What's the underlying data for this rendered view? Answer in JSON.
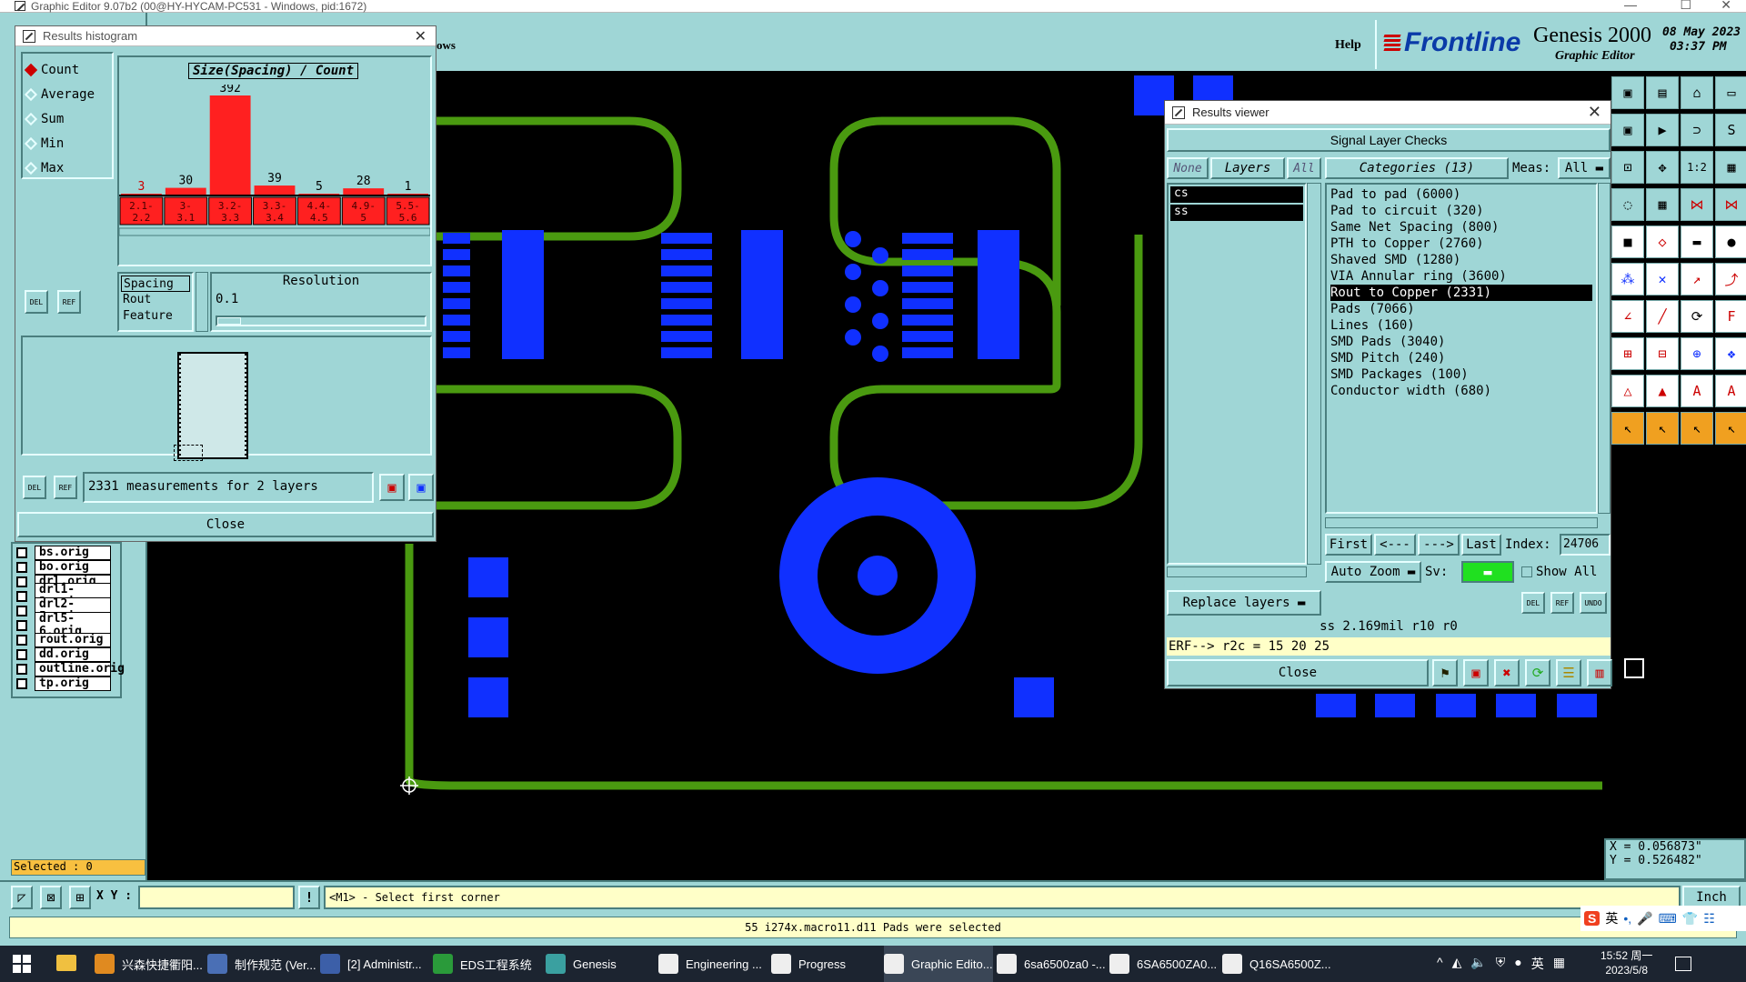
{
  "app": {
    "title": "Graphic Editor 9.07b2 (00@HY-HYCAM-PC531 - Windows, pid:1672)",
    "menu_partial": "ows",
    "help": "Help",
    "brand": "Frontline",
    "product": "Genesis 2000",
    "product_sub": "Graphic Editor",
    "date": "08 May 2023",
    "time": "03:37 PM"
  },
  "histogram": {
    "title": "Results histogram",
    "chart_title": "Size(Spacing) / Count",
    "modes": [
      {
        "label": "Count",
        "selected": true
      },
      {
        "label": "Average",
        "selected": false
      },
      {
        "label": "Sum",
        "selected": false
      },
      {
        "label": "Min",
        "selected": false
      },
      {
        "label": "Max",
        "selected": false
      }
    ],
    "types": [
      "Spacing",
      "Rout",
      "Feature"
    ],
    "resolution_label": "Resolution",
    "resolution_value": "0.1",
    "status": "2331 measurements for 2 layers",
    "close": "Close",
    "del": "DEL",
    "ref": "REF"
  },
  "chart_data": {
    "type": "bar",
    "title": "Size(Spacing) / Count",
    "categories": [
      "2.1-2.2",
      "3-3.1",
      "3.2-3.3",
      "3.3-3.4",
      "4.4-4.5",
      "4.9-5",
      "5.5-5.6"
    ],
    "values": [
      3,
      30,
      392,
      39,
      5,
      28,
      1
    ],
    "highlight_color": "#ff2020",
    "ylim": [
      0,
      392
    ]
  },
  "layers": {
    "items": [
      "bs.orig",
      "bo.orig",
      "drl.orig",
      "drl1-2.orig",
      "drl2-5.orig",
      "drl5-6.orig",
      "rout.orig",
      "dd.orig",
      "outline.orig",
      "tp.orig"
    ],
    "selected_label": "Selected : 0"
  },
  "viewer": {
    "title": "Results viewer",
    "header": "Signal Layer Checks",
    "none": "None",
    "layers_btn": "Layers",
    "all_btn": "All",
    "layer_list": [
      "cs",
      "ss"
    ],
    "categories_label": "Categories (13)",
    "meas_label": "Meas:",
    "meas_value": "All",
    "categories": [
      "Pad to pad (6000)",
      "Pad to circuit (320)",
      "Same Net Spacing (800)",
      "PTH to Copper (2760)",
      "Shaved SMD (1280)",
      "VIA Annular ring (3600)",
      "Rout to Copper (2331)",
      "Pads (7066)",
      "Lines (160)",
      "SMD Pads (3040)",
      "SMD Pitch (240)",
      "SMD Packages (100)",
      "Conductor width (680)"
    ],
    "selected_category": 6,
    "first": "First",
    "prev": "<---",
    "next": "--->",
    "last": "Last",
    "index_label": "Index:",
    "index_value": "24706",
    "auto_zoom": "Auto Zoom",
    "sv": "Sv:",
    "show_all": "Show All",
    "replace_layers": "Replace layers",
    "measure_info": "ss 2.169mil  r10  r0",
    "erf": "ERF--> r2c = 15 20 25",
    "close": "Close",
    "del": "DEL",
    "ref": "REF",
    "undo": "UNDO"
  },
  "coords": {
    "x": "X = 0.056873\"",
    "y": "Y = 0.526482\""
  },
  "bottom": {
    "xy_label": "X Y :",
    "xy_value": "",
    "prompt": "<M1> - Select first corner",
    "units": "Inch",
    "status": "55 i274x.macro11.d11 Pads were selected"
  },
  "taskbar": {
    "items": [
      {
        "label": "兴森快捷衢阳...",
        "color": "#e08a20"
      },
      {
        "label": "制作规范 (Ver...",
        "color": "#4a6fb5"
      },
      {
        "label": "[2] Administr...",
        "color": "#3c5fa8"
      },
      {
        "label": "EDS工程系统",
        "color": "#2a9a3a"
      },
      {
        "label": "Genesis",
        "color": "#3aa0a0"
      },
      {
        "label": "Engineering ...",
        "color": "#eee"
      },
      {
        "label": "Progress",
        "color": "#eee"
      },
      {
        "label": "Graphic Edito...",
        "color": "#eee"
      },
      {
        "label": "6sa6500za0 -...",
        "color": "#eee"
      },
      {
        "label": "6SA6500ZA0...",
        "color": "#eee"
      },
      {
        "label": "Q16SA6500Z...",
        "color": "#eee"
      }
    ],
    "clock_time": "15:52 周一",
    "clock_date": "2023/5/8",
    "ime": "英"
  },
  "colors": {
    "panel": "#9fd6d6",
    "canvas": "#000000",
    "copper": "#1030ff",
    "outline": "#4a9a10",
    "bar": "#ff2020",
    "yellow": "#ffffc8"
  }
}
